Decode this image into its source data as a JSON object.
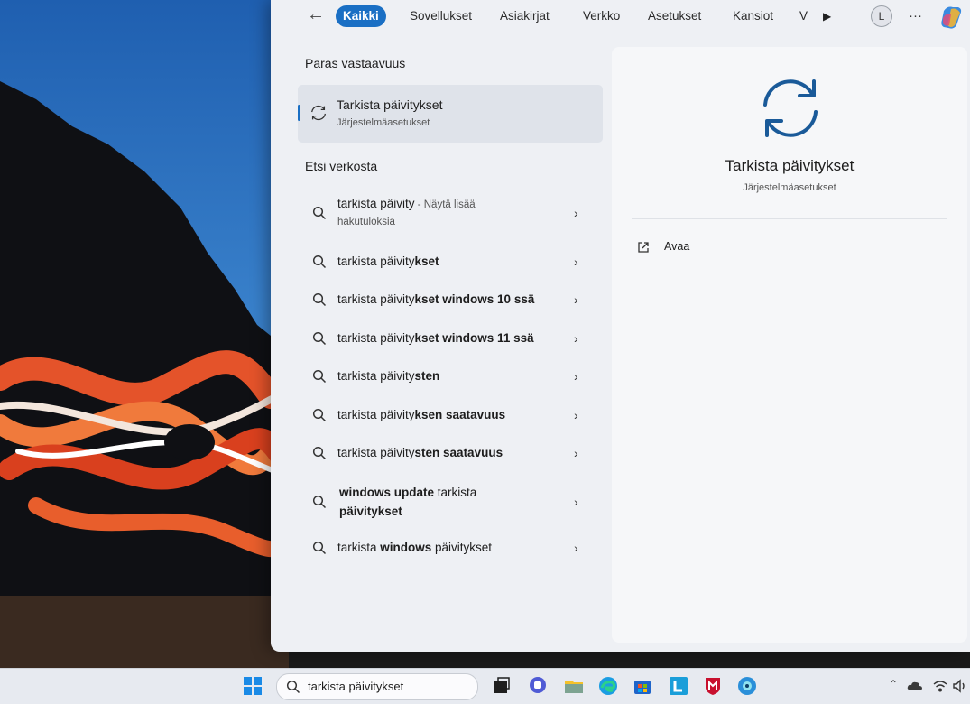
{
  "filters": {
    "back_icon": "back-arrow-icon",
    "items": [
      "Kaikki",
      "Sovellukset",
      "Asiakirjat",
      "Verkko",
      "Asetukset",
      "Kansiot",
      "V"
    ],
    "active": "Kaikki",
    "avatar_letter": "L",
    "more_label": "···"
  },
  "best_match": {
    "section_title": "Paras vastaavuus",
    "title": "Tarkista päivitykset",
    "subtitle": "Järjestelmäasetukset",
    "icon": "sync-icon"
  },
  "web": {
    "section_title": "Etsi verkosta",
    "results": [
      {
        "pre": "tarkista päivity",
        "bold": "",
        "hint": " - Näytä lisää",
        "line2": "hakutuloksia"
      },
      {
        "pre": "tarkista päivity",
        "bold": "kset",
        "hint": "",
        "line2": ""
      },
      {
        "pre": "tarkista päivity",
        "bold": "kset windows 10 ssä",
        "hint": "",
        "line2": ""
      },
      {
        "pre": "tarkista päivity",
        "bold": "kset windows 11 ssä",
        "hint": "",
        "line2": ""
      },
      {
        "pre": "tarkista päivity",
        "bold": "sten",
        "hint": "",
        "line2": ""
      },
      {
        "pre": "tarkista päivity",
        "bold": "ksen saatavuus",
        "hint": "",
        "line2": ""
      },
      {
        "pre": "tarkista päivity",
        "bold": "sten saatavuus",
        "hint": "",
        "line2": ""
      },
      {
        "pre": "",
        "bold": "windows update",
        "pre2": " tarkista",
        "line2": "päivitykset"
      },
      {
        "pre": "tarkista ",
        "bold": "windows",
        "pre2": " päivitykset",
        "line2": ""
      }
    ]
  },
  "detail": {
    "title": "Tarkista päivitykset",
    "subtitle": "Järjestelmäasetukset",
    "action_label": "Avaa",
    "action_icon": "open-external-icon"
  },
  "taskbar": {
    "search_value": "tarkista päivitykset",
    "apps": [
      "start-icon",
      "search-icon",
      "task-view-icon",
      "chat-icon",
      "file-explorer-icon",
      "edge-icon",
      "store-icon",
      "l-app-icon",
      "mcafee-icon",
      "eye-app-icon"
    ],
    "tray": [
      "chevron-up-icon",
      "onedrive-icon",
      "wifi-icon",
      "volume-icon"
    ]
  },
  "colors": {
    "accent": "#1a6fc4",
    "panel": "#eef0f4",
    "mcafee": "#c8102e"
  }
}
